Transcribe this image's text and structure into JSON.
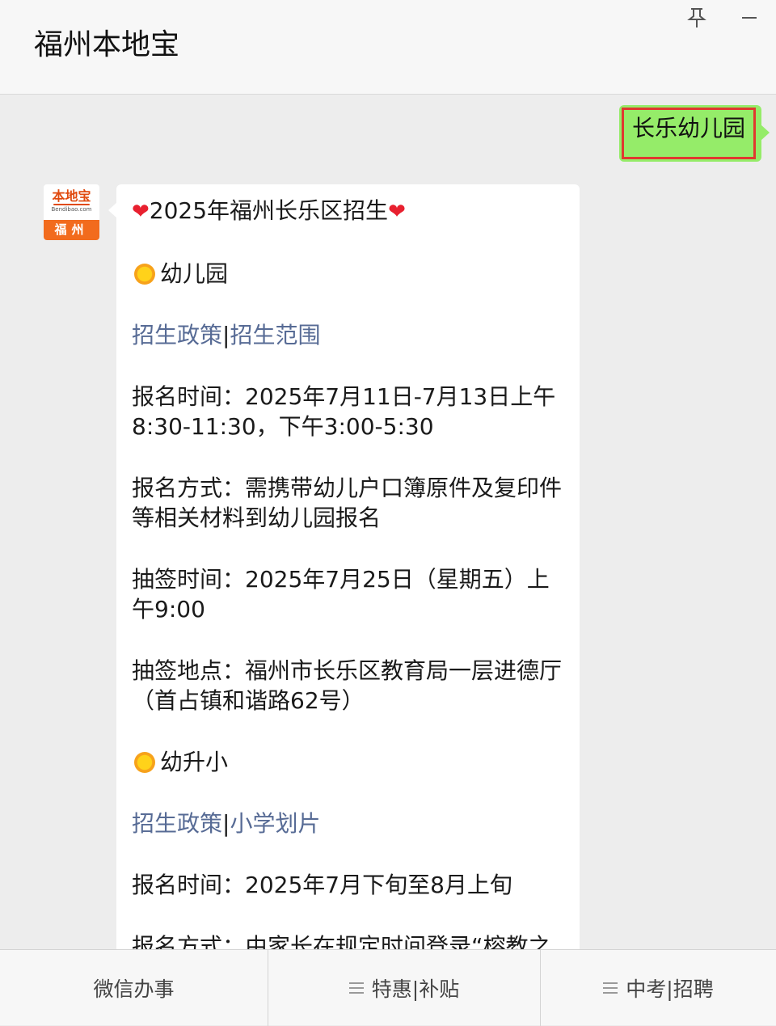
{
  "header": {
    "title": "福州本地宝"
  },
  "conversation": {
    "user_message": "长乐幼儿园",
    "avatar": {
      "brand": "本地宝",
      "domain": "Bendibao.com",
      "city": "福州"
    },
    "reply": {
      "title": "2025年福州长乐区招生",
      "heart_glyph": "❤",
      "section1": {
        "heading": "幼儿园",
        "link_policy": "招生政策",
        "separator": "|",
        "link_scope": "招生范围",
        "register_time": "报名时间：2025年7月11日-7月13日上午8:30-11:30，下午3:00-5:30",
        "register_method": "报名方式：需携带幼儿户口簿原件及复印件等相关材料到幼儿园报名",
        "lottery_time": "抽签时间：2025年7月25日（星期五）上午9:00",
        "lottery_place": "抽签地点：福州市长乐区教育局一层进德厅（首占镇和谐路62号）"
      },
      "section2": {
        "heading": "幼升小",
        "link_policy": "招生政策",
        "separator": "|",
        "link_district": "小学划片",
        "register_time": "报名时间：2025年7月下旬至8月上旬",
        "register_method_partial": "报名方式：由家长在规定时间登录“榕教之"
      }
    }
  },
  "bottom_menu": [
    {
      "label": "微信办事",
      "has_icon": false
    },
    {
      "label": "特惠|补贴",
      "has_icon": true
    },
    {
      "label": "中考|招聘",
      "has_icon": true
    }
  ],
  "colors": {
    "user_bubble": "#95ec69",
    "highlight_border": "#e0392f",
    "link": "#576b95",
    "avatar_accent": "#f26b1d"
  }
}
